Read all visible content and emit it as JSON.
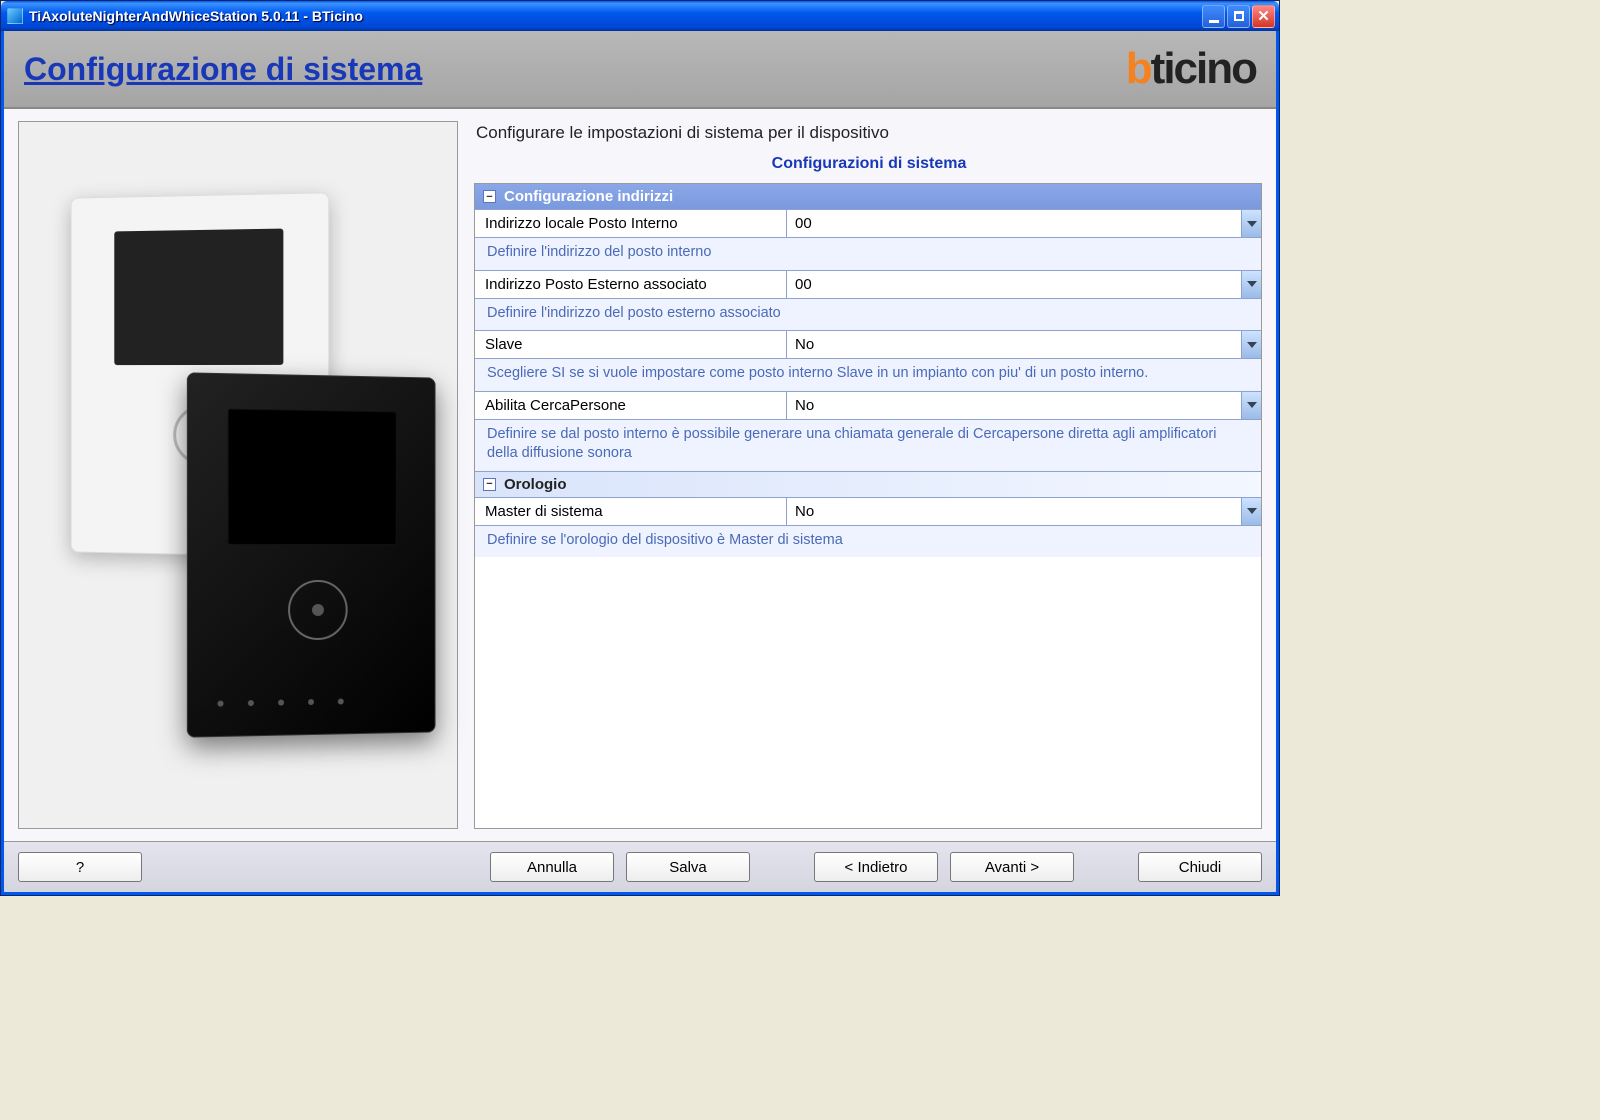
{
  "window": {
    "title": "TiAxoluteNighterAndWhiceStation 5.0.11 - BTicino"
  },
  "header": {
    "page_title": "Configurazione di sistema",
    "logo_b": "b",
    "logo_rest": "ticino"
  },
  "intro": {
    "subtitle": "Configurare le impostazioni di sistema per il dispositivo",
    "section_label": "Configurazioni di sistema"
  },
  "groups": {
    "addresses": {
      "title": "Configurazione indirizzi",
      "rows": {
        "local_addr": {
          "label": "Indirizzo locale Posto Interno",
          "value": "00",
          "hint": "Definire l'indirizzo del posto interno"
        },
        "ext_addr": {
          "label": "Indirizzo Posto Esterno associato",
          "value": "00",
          "hint": "Definire l'indirizzo del posto esterno associato"
        },
        "slave": {
          "label": "Slave",
          "value": "No",
          "hint": "Scegliere SI se si vuole impostare come posto interno Slave in un impianto con piu' di un posto interno."
        },
        "paging": {
          "label": "Abilita CercaPersone",
          "value": "No",
          "hint": "Definire se dal posto interno è possibile generare una chiamata generale di Cercapersone diretta agli amplificatori della diffusione sonora"
        }
      }
    },
    "clock": {
      "title": "Orologio",
      "rows": {
        "master": {
          "label": "Master di sistema",
          "value": "No",
          "hint": "Definire se l'orologio del dispositivo è Master di sistema"
        }
      }
    }
  },
  "footer": {
    "help": "?",
    "cancel": "Annulla",
    "save": "Salva",
    "back": "<  Indietro",
    "next": "Avanti  >",
    "close": "Chiudi"
  }
}
